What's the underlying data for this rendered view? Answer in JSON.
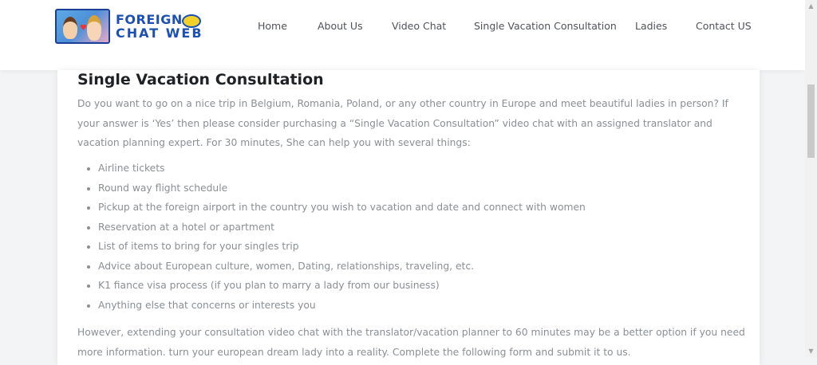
{
  "header": {
    "logo_line1": "FOREIGN",
    "logo_line2": "CHAT WEB",
    "nav": [
      {
        "label": "Home"
      },
      {
        "label": "About Us"
      },
      {
        "label": "Video Chat"
      },
      {
        "label": "Single Vacation Consultation"
      },
      {
        "label": "Ladies"
      },
      {
        "label": "Contact US"
      }
    ]
  },
  "content": {
    "title": "Single Vacation Consultation",
    "intro": "Do you want to go on a nice trip in Belgium, Romania, Poland, or any other country in Europe and meet beautiful ladies in person? If your answer is ‘Yes’ then please consider purchasing a “Single Vacation Consultation” video chat with an assigned translator and vacation planning expert. For 30 minutes, She can help you with several things:",
    "items": [
      "Airline tickets",
      "Round way flight schedule",
      "Pickup at the foreign airport in the country you wish to vacation and date and connect with women",
      "Reservation at a hotel or apartment",
      "List of items to bring for your singles trip",
      "Advice about European culture, women, Dating, relationships, traveling, etc.",
      "K1 fiance visa process (if you plan to marry a lady from our business)",
      "Anything else that concerns or interests you"
    ],
    "outro": "However, extending your consultation video chat with the translator/vacation planner to 60 minutes may be a better option if you need more information. turn your european dream lady into a reality. Complete the following form and submit it to us."
  },
  "colors": {
    "brand": "#1d50b4",
    "text_body": "#8a8f94",
    "heading": "#1e2225",
    "nav": "#4f5358"
  }
}
